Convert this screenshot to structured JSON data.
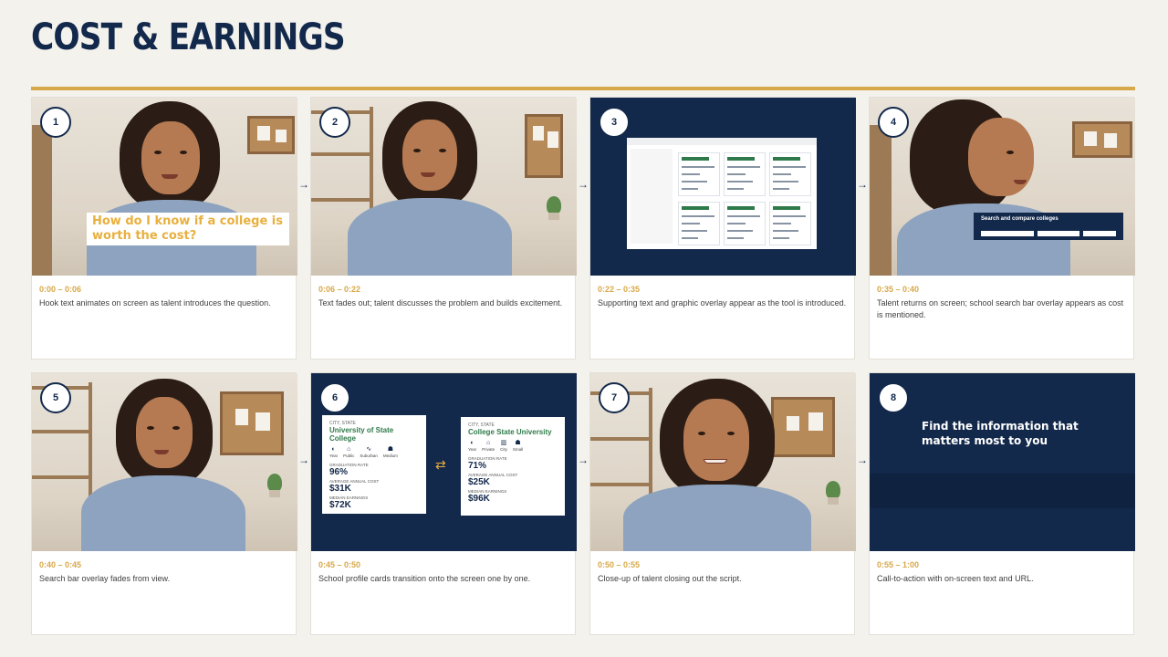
{
  "header": {
    "title": "COST & EARNINGS"
  },
  "colors": {
    "navy": "#13294b",
    "gold": "#d7a84a",
    "green": "#2f7a4a",
    "background": "#f4f2ed"
  },
  "panels": [
    {
      "number": "1",
      "time": "0:00 – 0:06",
      "description": "Hook text animates on screen as talent introduces the question.",
      "overlay_text": "How do I know if a college is worth the cost?"
    },
    {
      "number": "2",
      "time": "0:06 – 0:22",
      "description": "Text fades out; talent discusses the problem and builds excitement."
    },
    {
      "number": "3",
      "time": "0:22 – 0:35",
      "description": "Supporting text and graphic overlay appear as the tool is introduced."
    },
    {
      "number": "4",
      "time": "0:35 – 0:40",
      "description": "Talent returns on screen; school search bar overlay appears as cost is mentioned.",
      "overlay_text": "Search and compare colleges"
    },
    {
      "number": "5",
      "time": "0:40 – 0:45",
      "description": "Search bar overlay fades from view."
    },
    {
      "number": "6",
      "time": "0:45 – 0:50",
      "description": "School profile cards transition onto the screen one by one."
    },
    {
      "number": "7",
      "time": "0:50 – 0:55",
      "description": "Close-up of talent closing out the script."
    },
    {
      "number": "8",
      "time": "0:55 – 1:00",
      "description": "Call-to-action with on-screen text and URL.",
      "overlay_text": "Find the information that matters most to you"
    }
  ],
  "school_cards": [
    {
      "location": "CITY, STATE",
      "name": "University of State College",
      "icons": [
        "Year",
        "Public",
        "Suburban",
        "Medium"
      ],
      "grad_label": "GRADUATION RATE",
      "grad_rate": "96%",
      "cost_label": "AVERAGE ANNUAL COST",
      "cost": "$31K",
      "earn_label": "MEDIAN EARNINGS",
      "earnings": "$72K"
    },
    {
      "location": "CITY, STATE",
      "name": "College State University",
      "icons": [
        "Year",
        "Private",
        "City",
        "Small"
      ],
      "grad_label": "GRADUATION RATE",
      "grad_rate": "71%",
      "cost_label": "AVERAGE ANNUAL COST",
      "cost": "$25K",
      "earn_label": "MEDIAN EARNINGS",
      "earnings": "$96K"
    }
  ],
  "arrow_glyph": "→",
  "swap_glyph": "⇄"
}
